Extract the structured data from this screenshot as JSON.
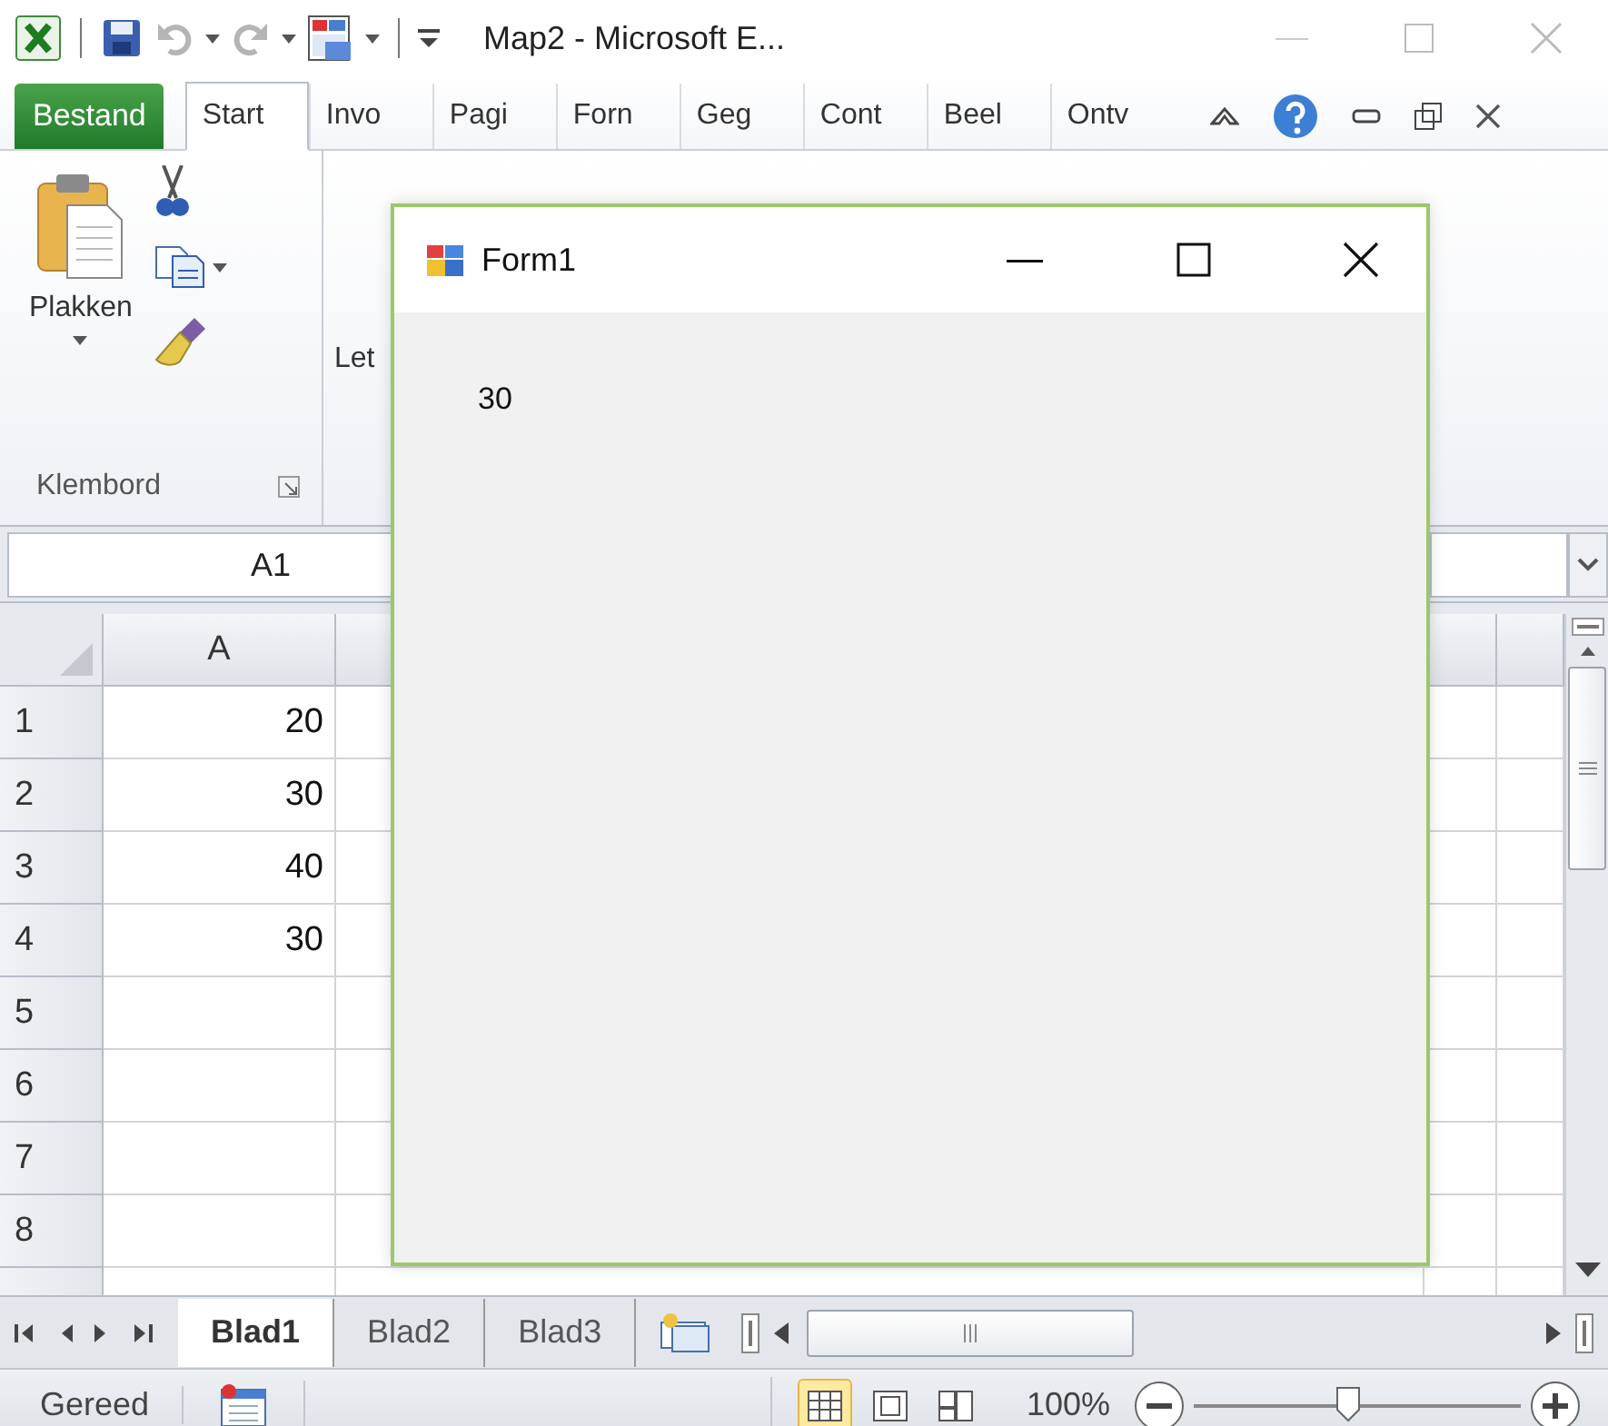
{
  "title_bar": {
    "title": "Map2 - Microsoft E..."
  },
  "ribbon": {
    "file_tab": "Bestand",
    "tabs": [
      {
        "label": "Start",
        "selected": true
      },
      {
        "label": "Invo",
        "selected": false
      },
      {
        "label": "Pagi",
        "selected": false
      },
      {
        "label": "Forn",
        "selected": false
      },
      {
        "label": "Geg",
        "selected": false
      },
      {
        "label": "Cont",
        "selected": false
      },
      {
        "label": "Beel",
        "selected": false
      },
      {
        "label": "Ontv",
        "selected": false
      }
    ],
    "clipboard": {
      "paste": "Plakken",
      "label": "Klembord"
    },
    "font_group": {
      "label": "Let"
    }
  },
  "formula_bar": {
    "name_box": "A1"
  },
  "sheet": {
    "columns": [
      "A"
    ],
    "rows": [
      {
        "header": "1",
        "cells": [
          "20"
        ]
      },
      {
        "header": "2",
        "cells": [
          "30"
        ]
      },
      {
        "header": "3",
        "cells": [
          "40"
        ]
      },
      {
        "header": "4",
        "cells": [
          "30"
        ]
      },
      {
        "header": "5",
        "cells": [
          ""
        ]
      },
      {
        "header": "6",
        "cells": [
          ""
        ]
      },
      {
        "header": "7",
        "cells": [
          ""
        ]
      },
      {
        "header": "8",
        "cells": [
          ""
        ]
      }
    ]
  },
  "sheet_tabs": [
    {
      "label": "Blad1",
      "selected": true
    },
    {
      "label": "Blad2",
      "selected": false
    },
    {
      "label": "Blad3",
      "selected": false
    }
  ],
  "status_bar": {
    "status": "Gereed",
    "views": [
      {
        "kind": "normal",
        "selected": true
      },
      {
        "kind": "page-layout",
        "selected": false
      },
      {
        "kind": "page-break",
        "selected": false
      }
    ],
    "zoom": "100%",
    "zoom_slider": {
      "level": 0.47
    }
  },
  "dialog": {
    "title": "Form1",
    "label": "30"
  }
}
